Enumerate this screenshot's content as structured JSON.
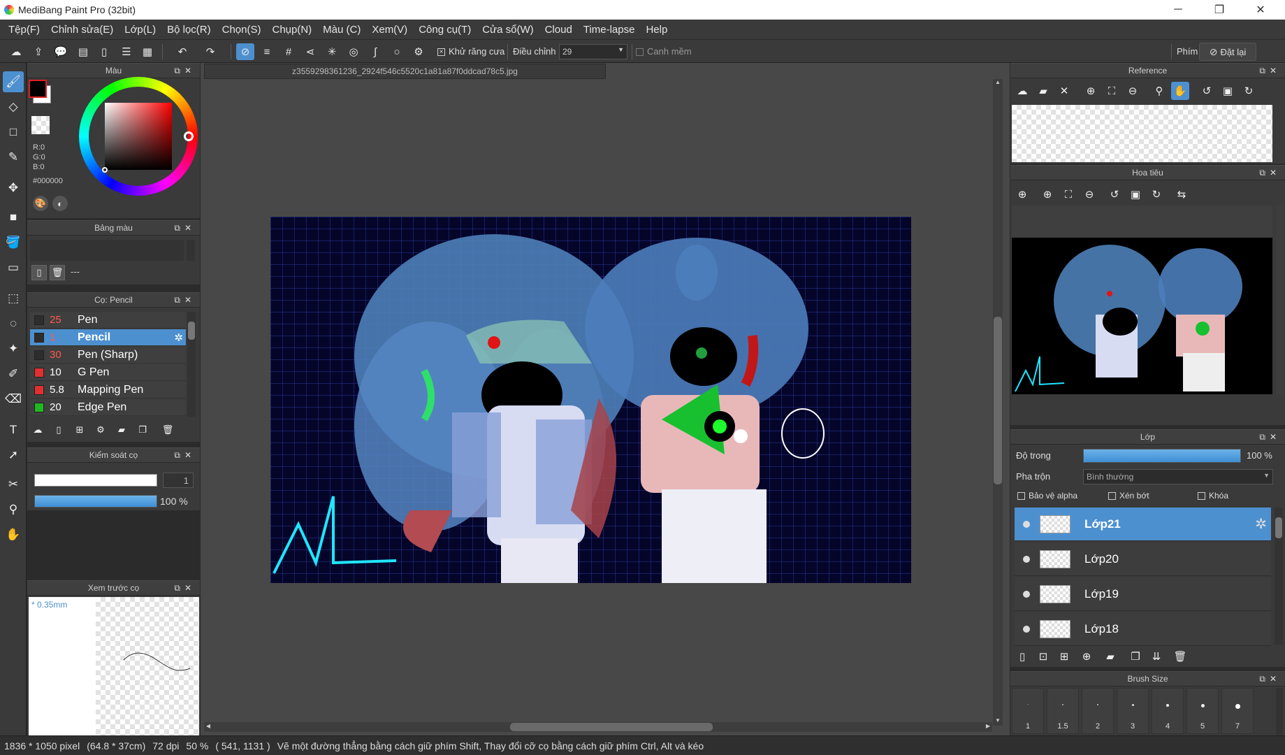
{
  "window": {
    "title": "MediBang Paint Pro (32bit)",
    "min_icon": "minimize-icon",
    "max_icon": "restore-icon",
    "close_icon": "close-icon"
  },
  "menu": [
    "Tệp(F)",
    "Chỉnh sửa(E)",
    "Lớp(L)",
    "Bộ lọc(R)",
    "Chọn(S)",
    "Chụp(N)",
    "Màu (C)",
    "Xem(V)",
    "Công cụ(T)",
    "Cửa sổ(W)",
    "Cloud",
    "Time-lapse",
    "Help"
  ],
  "toolbar": {
    "antialias_label": "Khử răng cưa",
    "correction_label": "Điều chỉnh",
    "correction_value": "29",
    "soft_edge_label": "Canh mềm",
    "key_label": "Phím",
    "reset_label": "Đặt lại",
    "accent": "#4d90d0"
  },
  "document": {
    "tab": "z3559298361236_2924f546c5520c1a81a87f0ddcad78c5.jpg"
  },
  "color_panel": {
    "title": "Màu",
    "r": "R:0",
    "g": "G:0",
    "b": "B:0",
    "hex": "#000000",
    "fg": "#000000",
    "bg": "#ffffff"
  },
  "palette_panel": {
    "title": "Bảng màu",
    "value": "---"
  },
  "brush_panel": {
    "title": "Cọ: Pencil",
    "items": [
      {
        "size": "25",
        "name": "Pen",
        "color": "#2d2d2d"
      },
      {
        "size": "1",
        "name": "Pencil",
        "color": "#2d2d2d"
      },
      {
        "size": "30",
        "name": "Pen (Sharp)",
        "color": "#2d2d2d"
      },
      {
        "size": "10",
        "name": "G Pen",
        "color": "#e03030"
      },
      {
        "size": "5.8",
        "name": "Mapping Pen",
        "color": "#e03030"
      },
      {
        "size": "20",
        "name": "Edge Pen",
        "color": "#1fb81f"
      }
    ]
  },
  "brush_control": {
    "title": "Kiểm soát cọ",
    "size_value": "1",
    "opacity_value": "100 %",
    "opacity_fraction": 1.0
  },
  "brush_preview": {
    "title": "Xem trước cọ",
    "size_label": "* 0.35mm"
  },
  "reference_panel": {
    "title": "Reference"
  },
  "navigator_panel": {
    "title": "Hoa tiêu"
  },
  "layer_panel": {
    "title": "Lớp",
    "opacity_label": "Độ trong",
    "opacity_value": "100 %",
    "opacity_fraction": 1.0,
    "blend_label": "Pha trộn",
    "blend_value": "Bình thường",
    "protect_alpha": "Bảo vệ alpha",
    "clipping": "Xén bớt",
    "lock": "Khóa",
    "layers": [
      "Lớp21",
      "Lớp20",
      "Lớp19",
      "Lớp18"
    ]
  },
  "brush_size_panel": {
    "title": "Brush Size",
    "sizes": [
      "1",
      "1.5",
      "2",
      "3",
      "4",
      "5",
      "7"
    ]
  },
  "status": {
    "dimensions": "1836 * 1050 pixel",
    "physical": "(64.8 * 37cm)",
    "dpi": "72 dpi",
    "zoom": "50 %",
    "coords": "( 541, 1131 )",
    "hint": "Vẽ một đường thẳng bằng cách giữ phím Shift, Thay đổi cỡ cọ bằng cách giữ phím Ctrl, Alt và kéo"
  }
}
